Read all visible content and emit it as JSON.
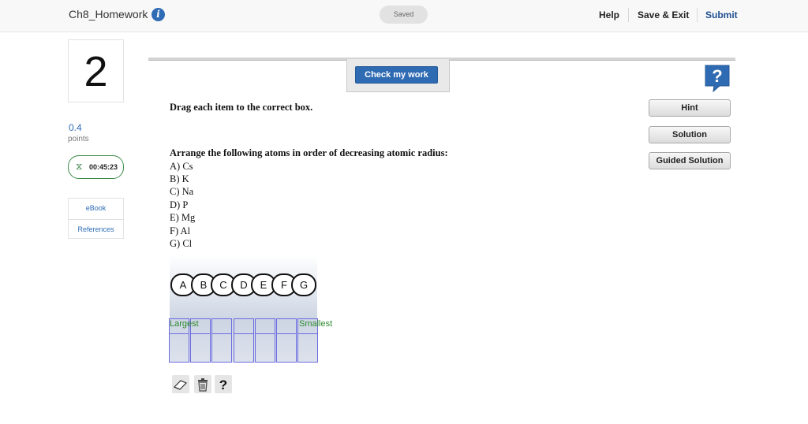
{
  "header": {
    "title": "Ch8_Homework",
    "info_icon": "i",
    "saved": "Saved",
    "help": "Help",
    "save_exit": "Save & Exit",
    "submit": "Submit"
  },
  "question": {
    "number": "2",
    "points_value": "0.4",
    "points_label": "points",
    "timer": "00:45:23",
    "links": [
      "eBook",
      "References"
    ]
  },
  "toolbar": {
    "check_label": "Check my work",
    "help_glyph": "?",
    "hint": "Hint",
    "solution": "Solution",
    "guided_solution": "Guided Solution"
  },
  "content": {
    "instruction": "Drag each item to the correct box.",
    "prompt": "Arrange the following atoms in order of decreasing atomic radius:",
    "options": [
      "A) Cs",
      "B) K",
      "C) Na",
      "D) P",
      "E) Mg",
      "F) Al",
      "G) Cl"
    ]
  },
  "drag": {
    "tokens": [
      "A",
      "B",
      "C",
      "D",
      "E",
      "F",
      "G"
    ],
    "left_label": "Largest",
    "right_label": "Smallest",
    "slot_count": 7
  },
  "tools": {
    "eraser_icon": "eraser-icon",
    "trash_icon": "trash-icon",
    "help_glyph": "?"
  },
  "colors": {
    "accent_blue": "#2f6bb3",
    "timer_green": "#3e8a4c",
    "label_green": "#2e8b2e",
    "slot_border": "#6a6ae0"
  }
}
